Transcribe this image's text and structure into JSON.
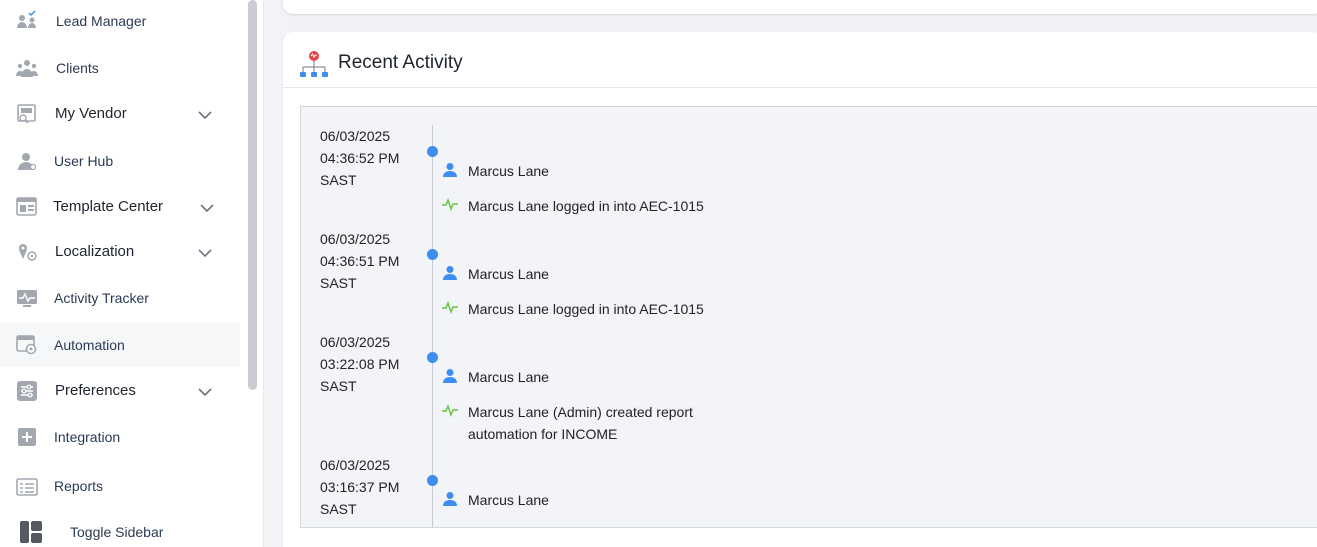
{
  "sidebar": {
    "items": [
      {
        "label": "Lead Manager",
        "icon": "lead-manager-icon",
        "has_chevron": false
      },
      {
        "label": "Clients",
        "icon": "clients-icon",
        "has_chevron": false
      },
      {
        "label": "My Vendor",
        "icon": "vendor-icon",
        "has_chevron": true
      },
      {
        "label": "User Hub",
        "icon": "user-icon",
        "has_chevron": false
      },
      {
        "label": "Template Center",
        "icon": "template-icon",
        "has_chevron": true
      },
      {
        "label": "Localization",
        "icon": "localization-icon",
        "has_chevron": true
      },
      {
        "label": "Activity Tracker",
        "icon": "activity-tracker-icon",
        "has_chevron": false
      },
      {
        "label": "Automation",
        "icon": "automation-icon",
        "has_chevron": false
      },
      {
        "label": "Preferences",
        "icon": "preferences-icon",
        "has_chevron": true
      },
      {
        "label": "Integration",
        "icon": "integration-icon",
        "has_chevron": false
      },
      {
        "label": "Reports",
        "icon": "reports-icon",
        "has_chevron": false
      }
    ],
    "toggle_label": "Toggle Sidebar"
  },
  "recent_activity": {
    "title": "Recent Activity",
    "entries": [
      {
        "date": "06/03/2025",
        "time": "04:36:52 PM",
        "tz": "SAST",
        "user": "Marcus Lane",
        "activity": "Marcus Lane logged in into AEC-1015"
      },
      {
        "date": "06/03/2025",
        "time": "04:36:51 PM",
        "tz": "SAST",
        "user": "Marcus Lane",
        "activity": "Marcus Lane logged in into AEC-1015"
      },
      {
        "date": "06/03/2025",
        "time": "03:22:08 PM",
        "tz": "SAST",
        "user": "Marcus Lane",
        "activity": "Marcus Lane (Admin) created report automation for INCOME"
      },
      {
        "date": "06/03/2025",
        "time": "03:16:37 PM",
        "tz": "SAST",
        "user": "Marcus Lane",
        "activity": ""
      }
    ]
  },
  "colors": {
    "accent": "#3d8ef0",
    "pulse": "#6cc24a",
    "icon_gray": "#9aa0a8"
  }
}
